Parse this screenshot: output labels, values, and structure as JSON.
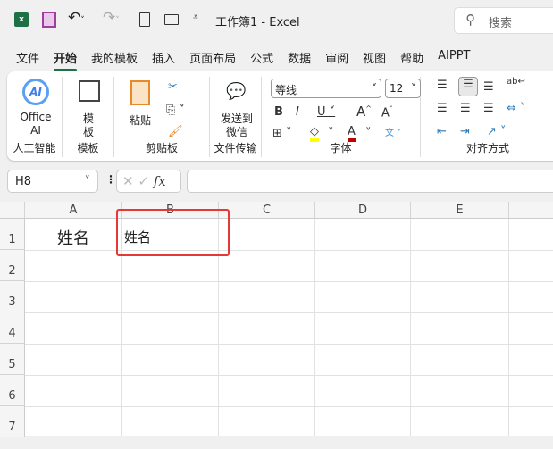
{
  "titlebar": {
    "title": "工作簿1  -  Excel",
    "search_placeholder": "搜索"
  },
  "tabs": [
    "文件",
    "开始",
    "我的模板",
    "插入",
    "页面布局",
    "公式",
    "数据",
    "审阅",
    "视图",
    "帮助",
    "AIPPT"
  ],
  "active_tab": "开始",
  "ribbon": {
    "office_ai": "Office AI",
    "group_ai": "人工智能",
    "template": "模板",
    "group_template": "模板",
    "paste": "粘贴",
    "group_clipboard": "剪贴板",
    "send_wechat": "发送到微信",
    "group_file": "文件传输",
    "font_name": "等线",
    "font_size": "12",
    "group_font": "字体",
    "group_align": "对齐方式",
    "fill_color": "#ffff00",
    "font_color": "#c00000"
  },
  "formula": {
    "name_box": "H8",
    "value": ""
  },
  "sheet": {
    "columns": [
      "A",
      "B",
      "C",
      "D",
      "E"
    ],
    "rows": [
      "1",
      "2",
      "3",
      "4",
      "5",
      "6",
      "7"
    ],
    "cells": {
      "A1": "姓名",
      "B1": "姓名"
    }
  },
  "highlight_color": "#e53935"
}
